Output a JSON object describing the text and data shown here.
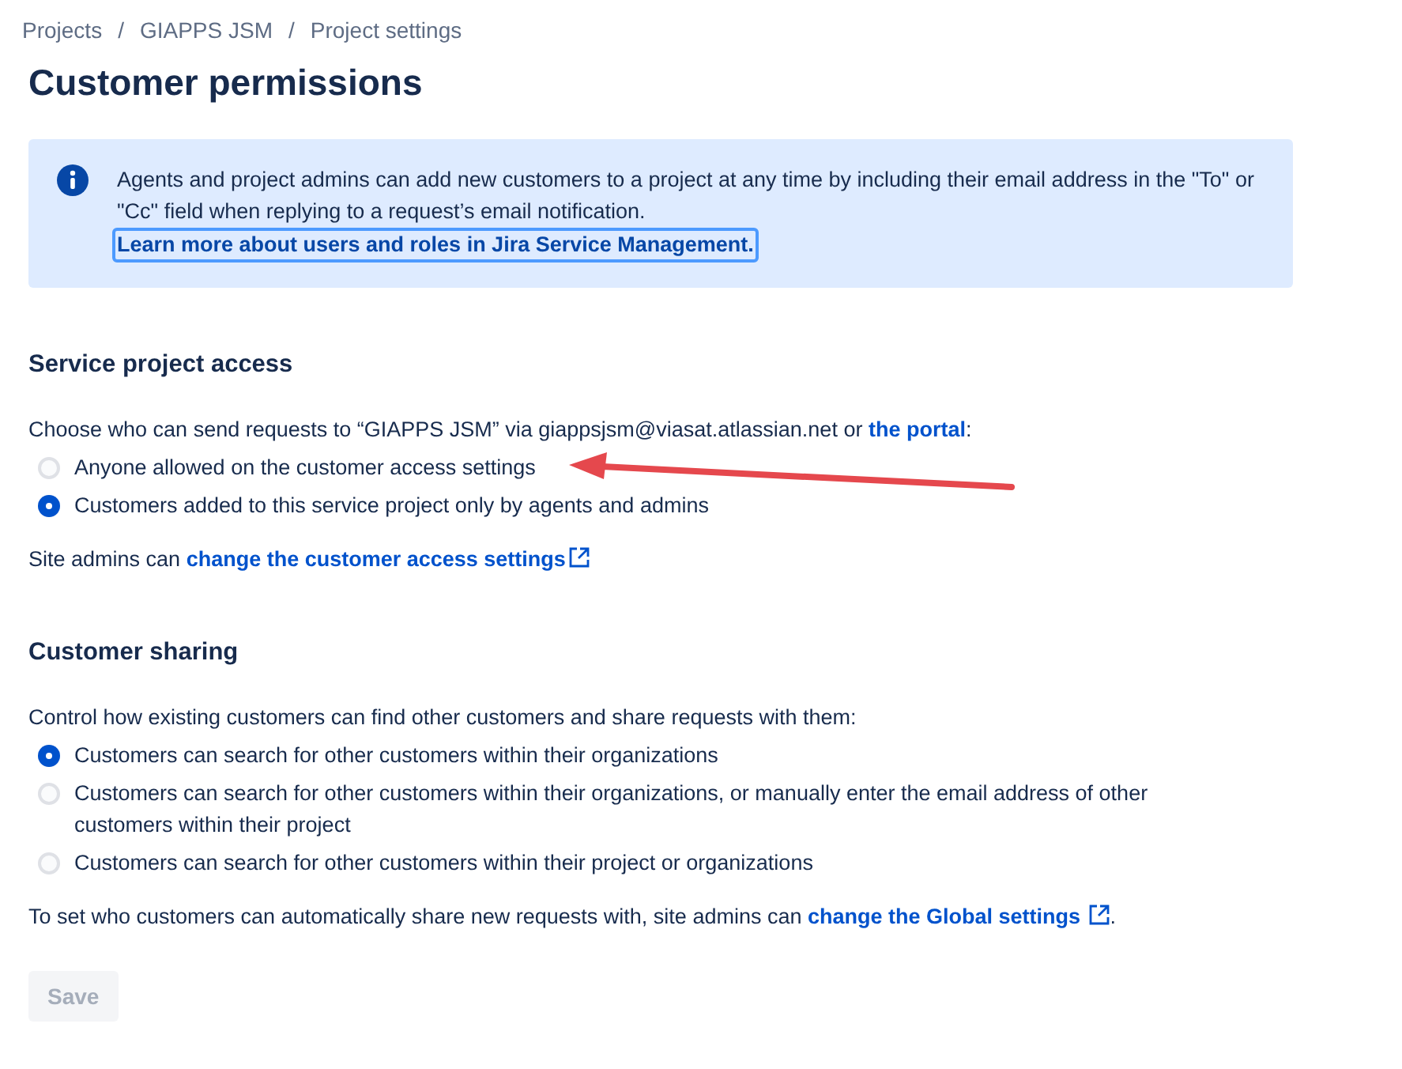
{
  "breadcrumbs": [
    {
      "label": "Projects",
      "separator": "/"
    },
    {
      "label": "GIAPPS JSM",
      "separator": "/"
    },
    {
      "label": "Project settings"
    }
  ],
  "title": "Customer permissions",
  "info": {
    "text": "Agents and project admins can add new customers to a project at any time by including their email address in the \"To\" or \"Cc\" field when replying to a request’s email notification.",
    "link": "Learn more about users and roles in Jira Service Management."
  },
  "sections": [
    {
      "heading": "Service project access",
      "intro": {
        "text": "Choose who can send requests to “GIAPPS JSM” via giappsjsm@viasat.atlassian.net or ",
        "link": "the portal",
        "after": ":"
      },
      "options": [
        {
          "label": "Anyone allowed on the customer access settings",
          "selected": false
        },
        {
          "label": "Customers added to this service project only by agents and admins",
          "selected": true
        }
      ],
      "note": {
        "text": "Site admins can ",
        "link": "change the customer access settings",
        "external": true
      }
    },
    {
      "heading": "Customer sharing",
      "intro": {
        "text": "Control how existing customers can find other customers and share requests with them:"
      },
      "options": [
        {
          "label": "Customers can search for other customers within their organizations",
          "selected": true
        },
        {
          "label": "Customers can search for other customers within their organizations, or manually enter the email address of other customers within their project",
          "selected": false
        },
        {
          "label": "Customers can search for other customers within their project or organizations",
          "selected": false
        }
      ],
      "note": {
        "text": "To set who customers can automatically share new requests with, site admins can ",
        "link": "change the Global settings",
        "after": ".",
        "external": true
      }
    }
  ],
  "save": {
    "label": "Save",
    "disabled": true
  }
}
